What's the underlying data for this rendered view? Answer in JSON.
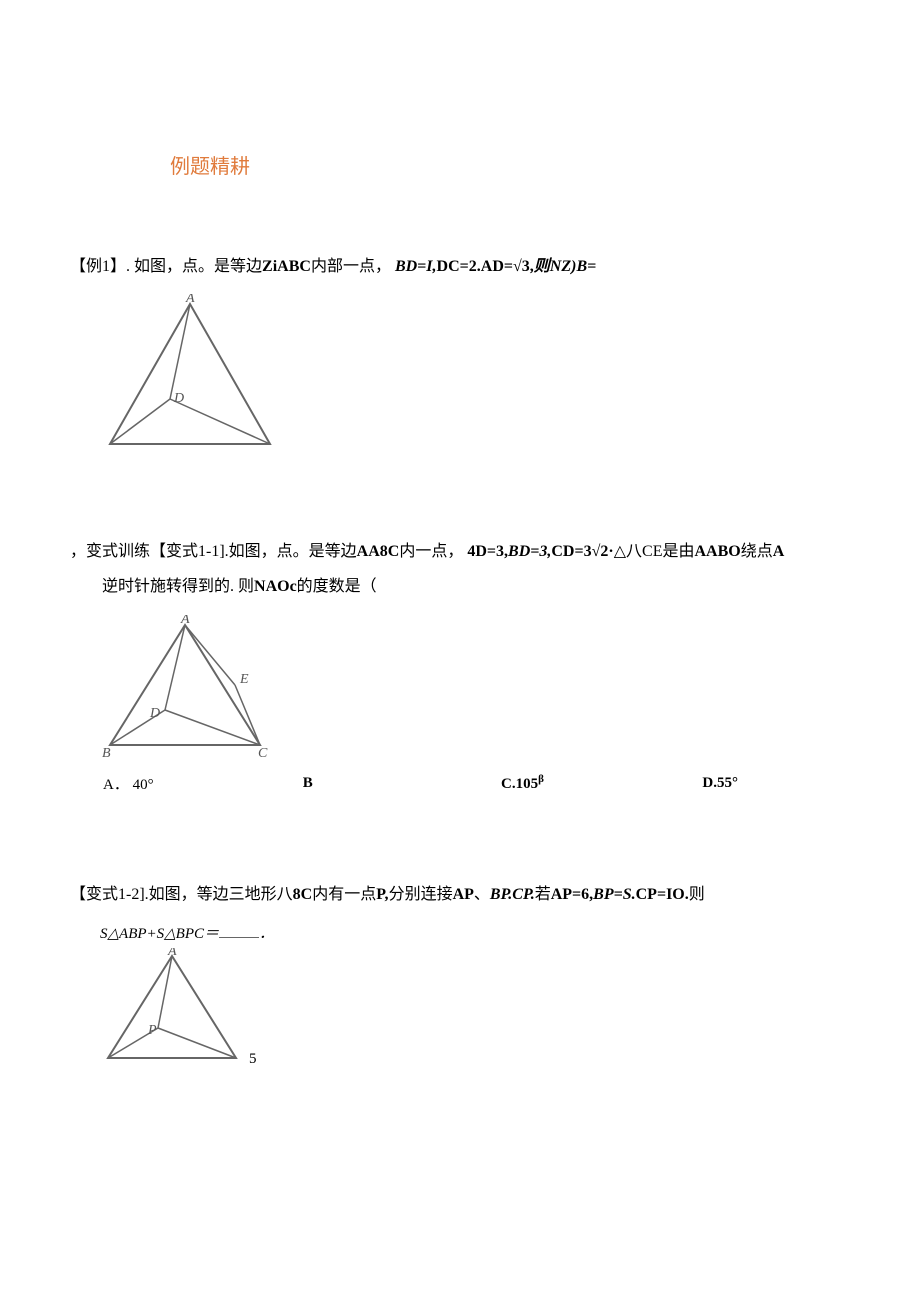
{
  "section_title": "例题精耕",
  "problem1": {
    "label_open": "【例1】",
    "text_lead": ". 如图，点。是等边",
    "tri": "ZiABC",
    "text_mid": "内部一点，",
    "eq1": "BD=I,",
    "eq2": "DC=2.",
    "eq3": "AD=√3,",
    "then": "则",
    "ans": "NZ)B="
  },
  "problem2": {
    "prefix": "，变式训练【变式1-1].如图，点。是等边",
    "tri": "AA8C",
    "mid1": "内一点，",
    "eq1": "4D=3,",
    "eq2": "BD=3,",
    "eq3": "CD=3√2·",
    "tri2": "△八CE",
    "mid2": "是由",
    "tri3": "AABO",
    "mid3": "绕点",
    "pt": "A",
    "line2a": "逆时针施转得到的. 则",
    "ang": "NAOc",
    "line2b": "的度数是（",
    "options": {
      "a_label": "A．",
      "a_val": "40°",
      "b_label": "B",
      "c_label": "C.",
      "c_val": "105",
      "c_sup": "β",
      "d_label": "D.",
      "d_val": "55°"
    }
  },
  "problem3": {
    "label": "【变式1-2].如图，等边三地形八",
    "tri": "8C",
    "mid1": "内有一点",
    "pt": "P,",
    "mid2": "分别连接",
    "seg1": "AP",
    "sep1": "、",
    "seg2": "BP.CP.",
    "mid3": "若",
    "eq1": "AP=6,",
    "eq2": "BP=S.",
    "eq3": "CP=IO.",
    "then": "则",
    "formula_lhs": "S△ABP+S△BPC＝",
    "formula_rhs": "．",
    "fig_label": "5"
  }
}
